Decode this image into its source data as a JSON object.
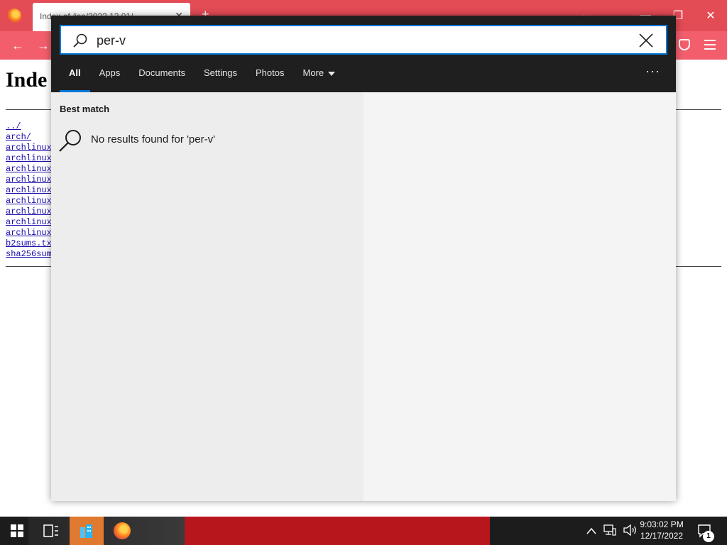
{
  "browser": {
    "tab_title": "Index of /iso/2022.12.01/",
    "tab_close": "✕",
    "new_tab": "+",
    "list_tabs": "⌄",
    "window_controls": {
      "minimize": "—",
      "restore": "❐",
      "close": "✕"
    },
    "nav": {
      "back": "←",
      "forward": "→"
    }
  },
  "page": {
    "heading": "Inde",
    "links": [
      "../",
      "arch/",
      "archlinux",
      "archlinux",
      "archlinux",
      "archlinux",
      "archlinux",
      "archlinux",
      "archlinux",
      "archlinux",
      "archlinux",
      "b2sums.tx",
      "sha256sum"
    ]
  },
  "search": {
    "query": "per-v",
    "tabs": [
      {
        "label": "All",
        "active": true
      },
      {
        "label": "Apps",
        "active": false
      },
      {
        "label": "Documents",
        "active": false
      },
      {
        "label": "Settings",
        "active": false
      },
      {
        "label": "Photos",
        "active": false
      },
      {
        "label": "More",
        "active": false
      }
    ],
    "ellipsis": "···",
    "best_match_label": "Best match",
    "no_results_text": "No results found for 'per-v'",
    "accent_color": "#0078d7"
  },
  "taskbar": {
    "clock_time": "9:03:02 PM",
    "clock_date": "12/17/2022",
    "notification_count": "1",
    "tray_chevron": "^"
  }
}
